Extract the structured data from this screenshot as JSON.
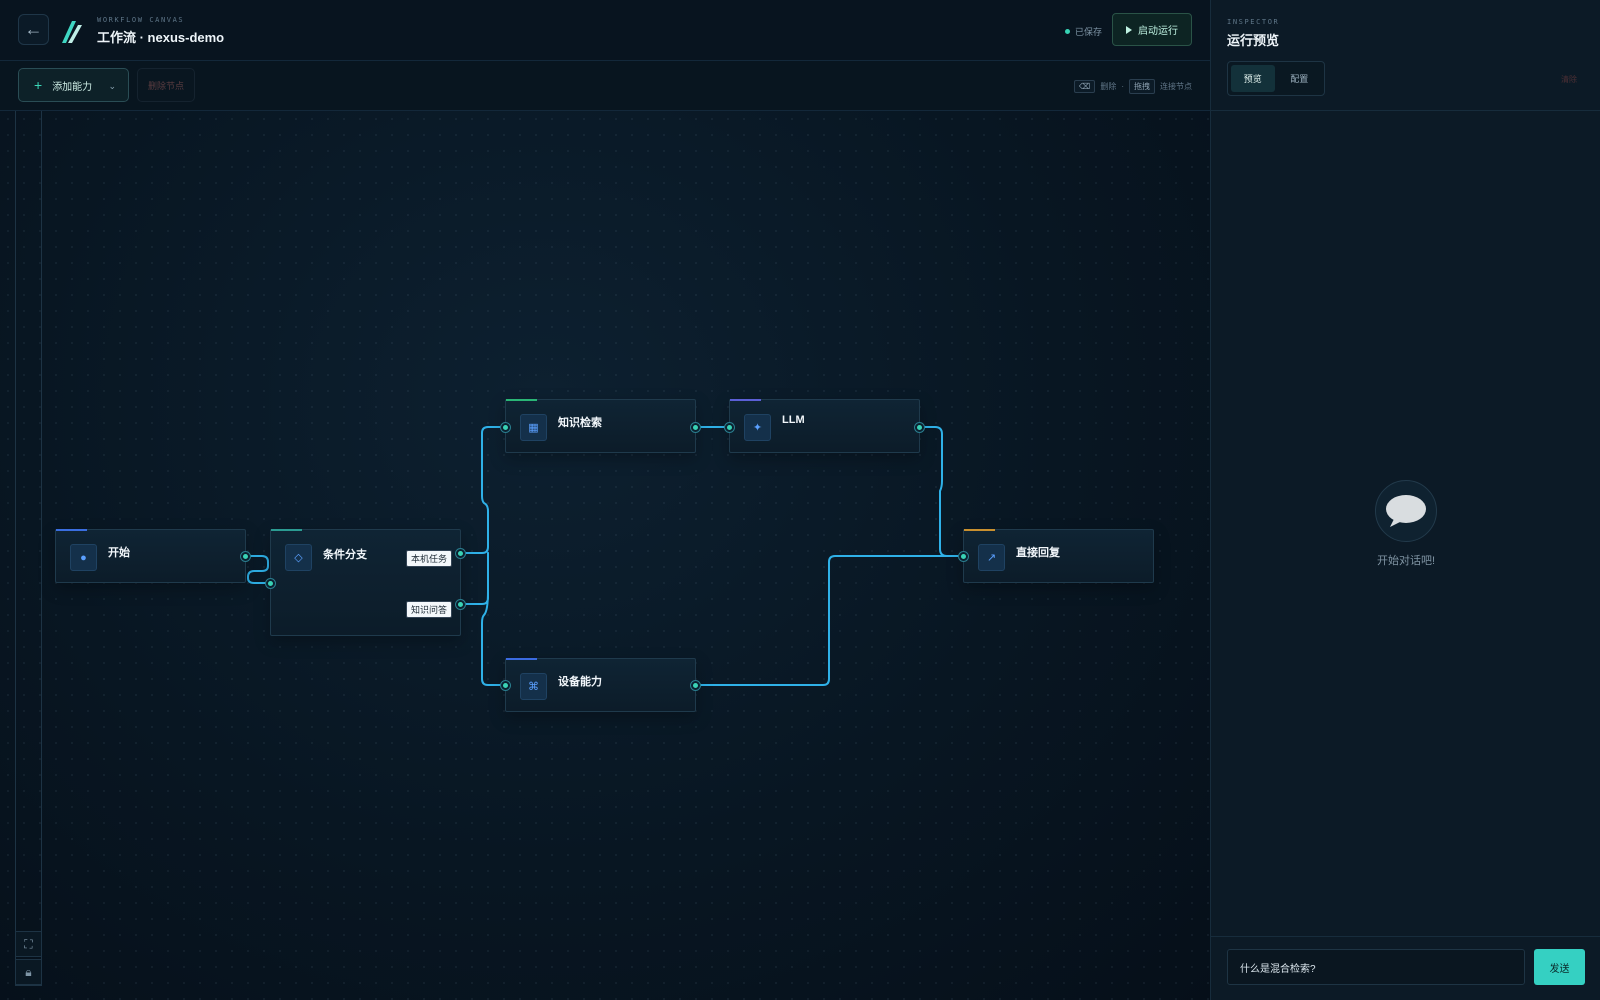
{
  "header": {
    "back_icon": "arrow-left-icon",
    "eyebrow": "WORKFLOW CANVAS",
    "title": "工作流 · nexus-demo",
    "saved_status": "已保存",
    "run_label": "启动运行",
    "accent": "#37d3b4"
  },
  "toolbar": {
    "add_label": "添加能力",
    "delete_label": "删除节点",
    "hint_delete_key": "⌫",
    "hint_delete_text": "删除",
    "hint_sep": "·",
    "hint_drag_key": "拖拽",
    "hint_drag_text": "连接节点"
  },
  "rail": {
    "fit_icon": "fullscreen-icon",
    "lock_icon": "lock-icon"
  },
  "nodes": {
    "start": {
      "label": "开始",
      "icon": "dot-icon",
      "accent": "#3a6ee0"
    },
    "condition": {
      "label": "条件分支",
      "icon": "diamond-icon",
      "accent": "#2b9b92",
      "branches": [
        "本机任务",
        "知识问答"
      ]
    },
    "knowledge": {
      "label": "知识检索",
      "icon": "grid-icon",
      "accent": "#2ab676"
    },
    "llm": {
      "label": "LLM",
      "icon": "sparkle-icon",
      "accent": "#5b5fd6"
    },
    "device": {
      "label": "设备能力",
      "icon": "command-icon",
      "accent": "#3b6be0"
    },
    "reply": {
      "label": "直接回复",
      "icon": "arrow-up-right-icon",
      "accent": "#c9902f"
    }
  },
  "inspector": {
    "eyebrow": "INSPECTOR",
    "title": "运行预览",
    "tabs": [
      "预览",
      "配置"
    ],
    "clear_label": "清除",
    "empty_icon": "speech-bubble-icon",
    "empty_text": "开始对话吧!",
    "input_value": "什么是混合检索?",
    "send_label": "发送"
  }
}
